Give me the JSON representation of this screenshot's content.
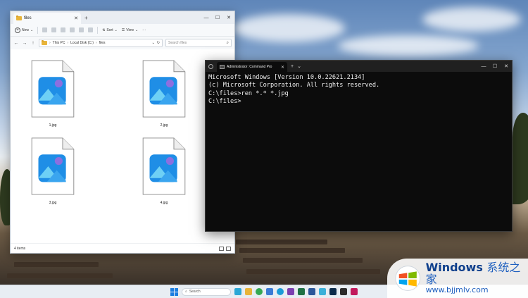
{
  "explorer": {
    "tab_title": "files",
    "toolbar": {
      "new_label": "New",
      "sort_label": "Sort",
      "view_label": "View",
      "more_label": "···"
    },
    "breadcrumb": [
      "This PC",
      "Local Disk (C:)",
      "files"
    ],
    "search_placeholder": "Search files",
    "files": [
      {
        "name": "1.jpg"
      },
      {
        "name": "2.jpg"
      },
      {
        "name": "3.jpg"
      },
      {
        "name": "4.jpg"
      }
    ],
    "status": "4 items"
  },
  "cmd": {
    "tab_title": "Administrator: Command Pro",
    "lines": [
      "Microsoft Windows [Version 10.0.22621.2134]",
      "(c) Microsoft Corporation. All rights reserved.",
      "",
      "C:\\files>ren *.* *.jpg",
      "",
      "C:\\files>"
    ]
  },
  "taskbar": {
    "search_label": "Search",
    "apps": [
      {
        "name": "copilot",
        "color": "#2aa7d6"
      },
      {
        "name": "file-explorer",
        "color": "#e8b43a"
      },
      {
        "name": "chrome",
        "color": "#34a853"
      },
      {
        "name": "app-store",
        "color": "#3a7bd5"
      },
      {
        "name": "edge",
        "color": "#1a9bd7"
      },
      {
        "name": "onenote",
        "color": "#7b3fb0"
      },
      {
        "name": "excel",
        "color": "#1e7145"
      },
      {
        "name": "word",
        "color": "#2b579a"
      },
      {
        "name": "notepad",
        "color": "#3bb0d9"
      },
      {
        "name": "photoshop",
        "color": "#0b2a4a"
      },
      {
        "name": "terminal",
        "color": "#2b2b2b"
      },
      {
        "name": "snipping",
        "color": "#c2185b"
      }
    ]
  },
  "watermark": {
    "title": "Windows",
    "title_cn": "系统之家",
    "url": "www.bjjmlv.com"
  },
  "colors": {
    "accent": "#1a7de0",
    "cmd_bg": "#0c0c0c",
    "folder": "#e8b43a"
  }
}
